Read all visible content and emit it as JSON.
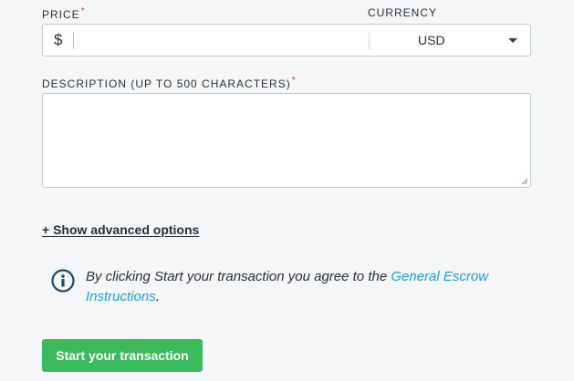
{
  "form": {
    "price": {
      "label": "PRICE",
      "required_marker": "*",
      "currency_symbol": "$",
      "value": "",
      "placeholder": ""
    },
    "currency": {
      "label": "CURRENCY",
      "selected": "USD"
    },
    "description": {
      "label": "DESCRIPTION (UP TO 500 CHARACTERS)",
      "required_marker": "*",
      "value": "",
      "placeholder": ""
    },
    "advanced_options_link": "+ Show advanced options",
    "notice": {
      "icon": "info-icon",
      "text_before": "By clicking Start your transaction you agree to the ",
      "link_text": "General Escrow Instructions",
      "text_after": "."
    },
    "submit_label": "Start your transaction"
  },
  "colors": {
    "accent_green": "#3cb95d",
    "link_blue": "#1e9fd4",
    "icon_navy": "#1d4a5e",
    "required_red": "#d9302a"
  }
}
